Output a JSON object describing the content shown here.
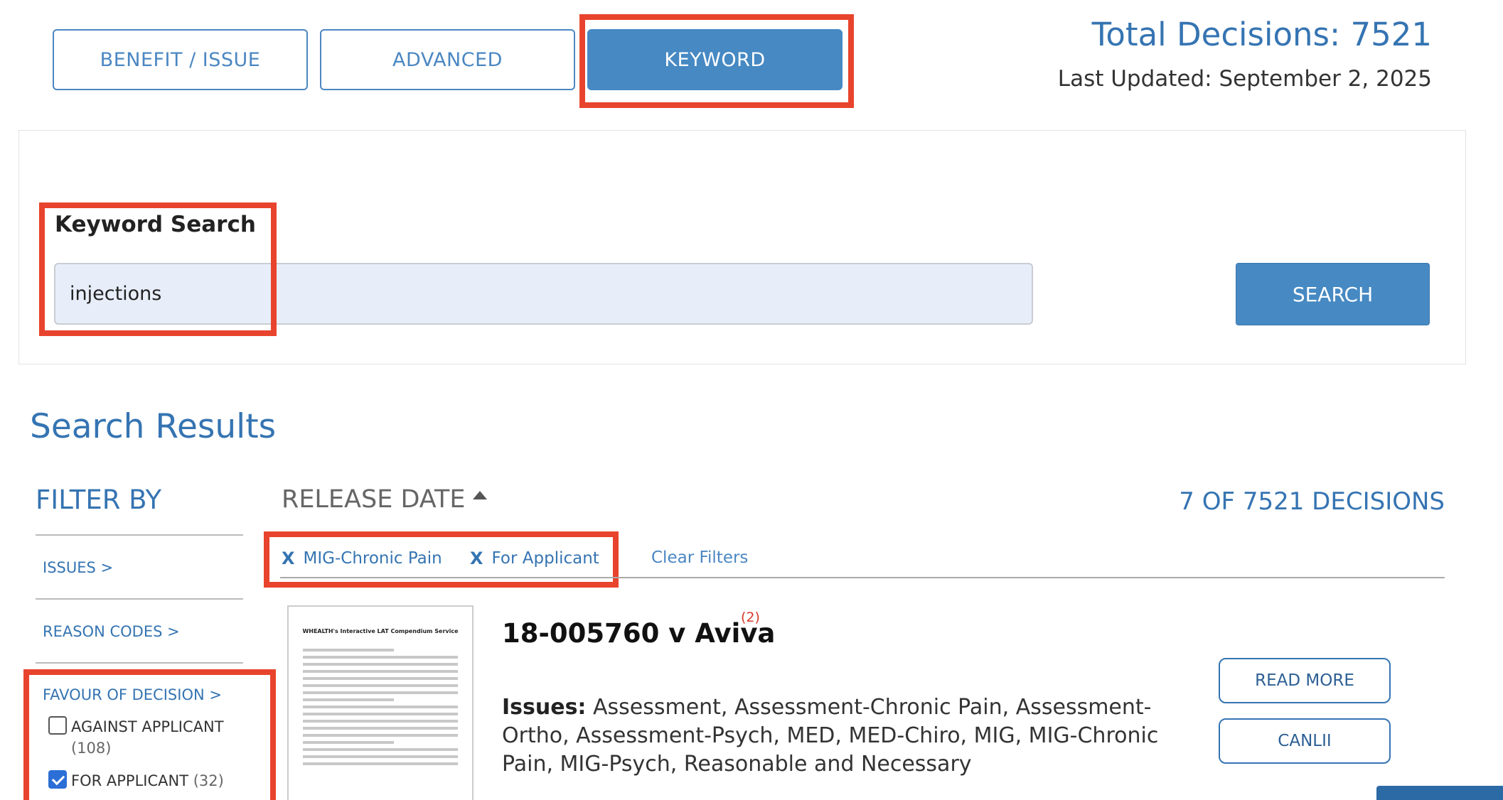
{
  "tabs": [
    {
      "label": "BENEFIT / ISSUE",
      "active": false
    },
    {
      "label": "ADVANCED",
      "active": false
    },
    {
      "label": "KEYWORD",
      "active": true
    }
  ],
  "header": {
    "total_decisions": "Total Decisions: 7521",
    "last_updated": "Last Updated: September 2, 2025"
  },
  "search": {
    "label": "Keyword Search",
    "value": "injections",
    "button_label": "SEARCH"
  },
  "results": {
    "title": "Search Results",
    "sort_label": "RELEASE DATE",
    "count_label": "7 OF 7521 DECISIONS",
    "active_filters": [
      {
        "x": "X",
        "label": "MIG-Chronic Pain"
      },
      {
        "x": "X",
        "label": "For Applicant"
      }
    ],
    "clear_filters": "Clear Filters"
  },
  "filter": {
    "title": "FILTER BY",
    "items": [
      "ISSUES >",
      "REASON CODES >",
      "FAVOUR OF DECISION >"
    ],
    "favour_options": [
      {
        "label": "AGAINST APPLICANT",
        "count": "(108)",
        "checked": false
      },
      {
        "label": "FOR APPLICANT",
        "count": "(32)",
        "checked": true
      }
    ]
  },
  "case": {
    "thumbnail_title": "WHEALTH's Interactive LAT Compendium Service",
    "title": "18-005760 v Aviva",
    "superscript": "(2)",
    "issues_label": "Issues:",
    "issues_text": " Assessment, Assessment-Chronic Pain, Assessment-Ortho, Assessment-Psych, MED, MED-Chiro, MIG, MIG-Chronic Pain, MIG-Psych, Reasonable and Necessary",
    "read_more": "READ MORE",
    "canlii": "CANLII"
  },
  "colors": {
    "accent": "#4689c3",
    "link": "#3574b2",
    "highlight_box": "#e8442d"
  }
}
